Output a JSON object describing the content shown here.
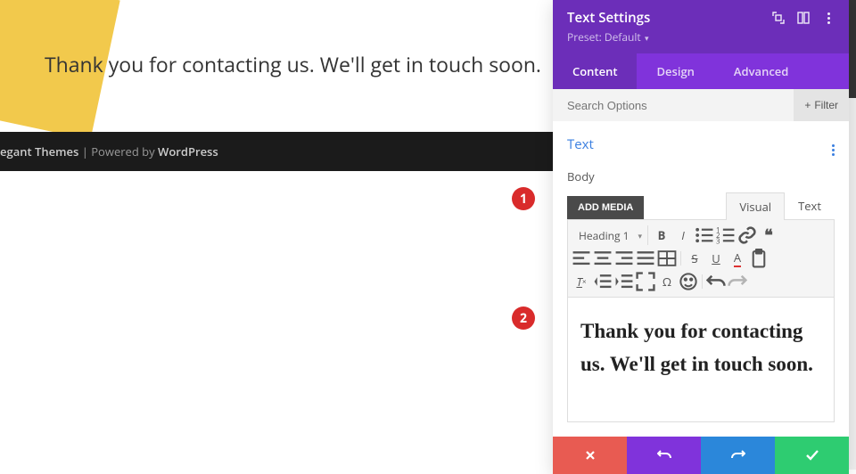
{
  "page_text": "Thank you for contacting us. We'll get in touch soon.",
  "footer": {
    "prefix": "egant Themes",
    "sep": " | Powered by ",
    "platform": "WordPress"
  },
  "panel": {
    "title": "Text Settings",
    "preset_label": "Preset: Default",
    "tabs": [
      "Content",
      "Design",
      "Advanced"
    ],
    "active_tab": 0,
    "search_placeholder": "Search Options",
    "filter_label": "Filter",
    "section_title": "Text",
    "body_label": "Body",
    "add_media": "ADD MEDIA",
    "editor_tabs": [
      "Visual",
      "Text"
    ],
    "editor_active": 0,
    "heading_label": "Heading 1",
    "body_content": "Thank you for contacting us. We'll get in touch soon."
  },
  "callouts": [
    "1",
    "2"
  ]
}
